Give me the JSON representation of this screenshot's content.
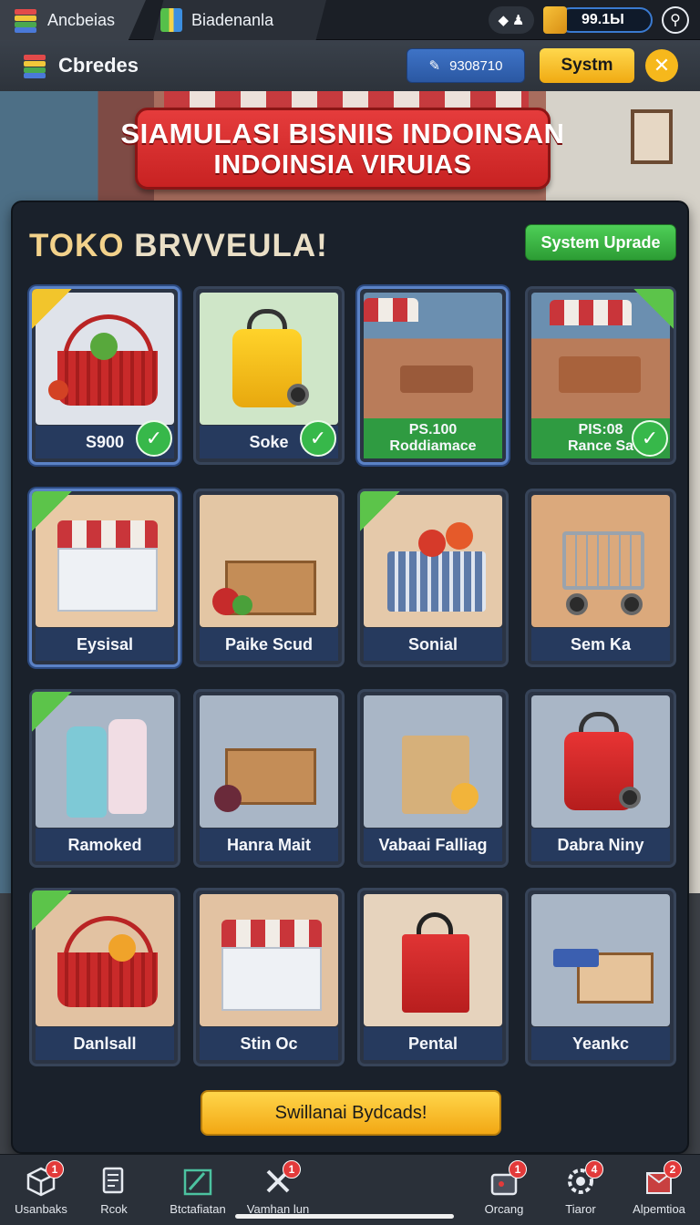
{
  "tabs": [
    {
      "label": "Ancbeias"
    },
    {
      "label": "Biadenanla"
    }
  ],
  "header": {
    "coin_value": "99.1Ы",
    "app_title": "Cbredes",
    "blue_pill_value": "9308710",
    "system_button": "Systm"
  },
  "banner": {
    "line1": "SIAMULASI BISNIIS INDOINSAN",
    "line2": "INDOINSIA VIRUIAS"
  },
  "shop": {
    "title_word1": "TOKO",
    "title_word2": "BRVVEULA!",
    "upgrade_button": "System Uprade"
  },
  "items": [
    {
      "label": "S900",
      "checked": true,
      "tag": "gold"
    },
    {
      "label": "Soke",
      "checked": true,
      "tag": ""
    },
    {
      "label": "PS.100",
      "sub": "Roddiamace",
      "checked": false,
      "tag": ""
    },
    {
      "label": "PIS:08",
      "sub": "Rance Sa",
      "checked": true,
      "tag": "green-right"
    },
    {
      "label": "Eysisal",
      "tag": "green"
    },
    {
      "label": "Paike Scud",
      "tag": ""
    },
    {
      "label": "Sonial",
      "tag": "green"
    },
    {
      "label": "Sem Ka",
      "tag": ""
    },
    {
      "label": "Ramoked",
      "tag": "green"
    },
    {
      "label": "Hanra Mait",
      "tag": ""
    },
    {
      "label": "Vabaai Falliag",
      "tag": ""
    },
    {
      "label": "Dabra Niny",
      "tag": ""
    },
    {
      "label": "Danlsall",
      "tag": "green"
    },
    {
      "label": "Stin Oc",
      "tag": ""
    },
    {
      "label": "Pental",
      "tag": ""
    },
    {
      "label": "Yeankc",
      "tag": ""
    }
  ],
  "cta": {
    "label": "Swillanai Bydcads!"
  },
  "bottom_nav": [
    {
      "label": "Usanbaks",
      "badge": "1"
    },
    {
      "label": "Rcok",
      "badge": ""
    },
    {
      "label": "Btctafiatan",
      "badge": ""
    },
    {
      "label": "Vamhan lun",
      "badge": "1"
    },
    {
      "label": "Orcang",
      "badge": "1"
    },
    {
      "label": "Tiaror",
      "badge": "4"
    },
    {
      "label": "Alpemtioa",
      "badge": "2"
    }
  ],
  "colors": {
    "accent_yellow": "#f0aa12",
    "accent_green": "#37b84a",
    "banner_red": "#d62e2e",
    "panel_bg": "#1a212b"
  }
}
